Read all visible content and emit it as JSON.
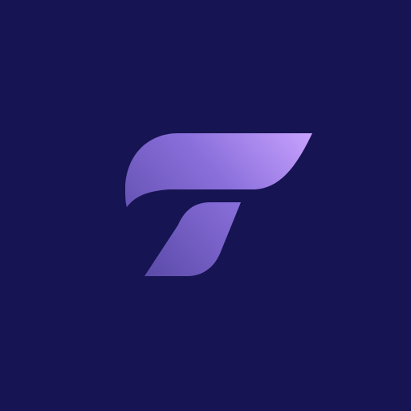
{
  "app_icon": {
    "mark": "T",
    "icon": "stylized-t-logo-icon",
    "colors": {
      "background": "#161452",
      "gradient_start": "#5a4aa8",
      "gradient_mid": "#8a6fdb",
      "gradient_end": "#c9a3ff"
    }
  }
}
